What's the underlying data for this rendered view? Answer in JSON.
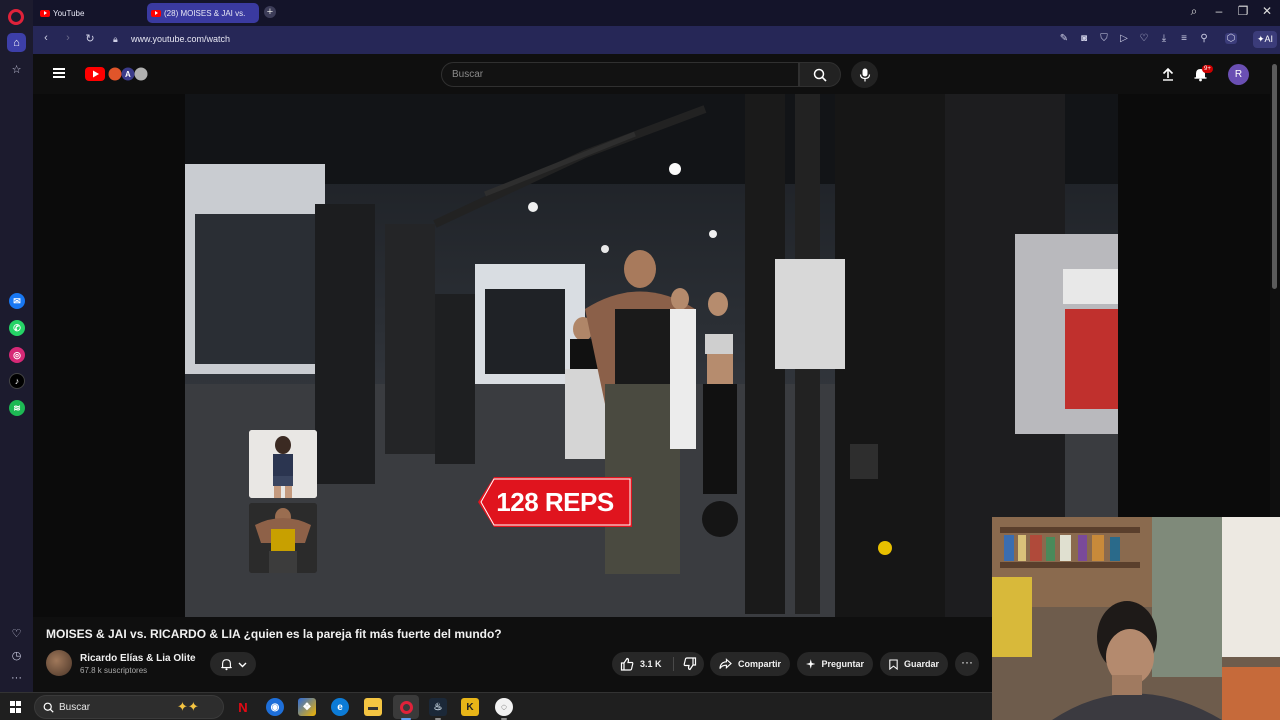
{
  "browser": {
    "tabs": [
      {
        "title": "YouTube",
        "active": false
      },
      {
        "title": "(28) MOISES & JAI vs.",
        "active": true
      }
    ],
    "url": "www.youtube.com/watch",
    "ai_label": "AI"
  },
  "youtube": {
    "search_placeholder": "Buscar",
    "notification_count": "9+",
    "avatar_letter": "R"
  },
  "video": {
    "overlay_reps": "128 REPS",
    "title": "MOISES & JAI vs. RICARDO & LIA ¿quien es la pareja fit más fuerte del mundo?",
    "channel_name": "Ricardo Elías & Lia Olite",
    "subscribers": "67.8 k suscriptores",
    "actions": {
      "likes": "3.1 K",
      "share": "Compartir",
      "ask": "Preguntar",
      "save": "Guardar"
    }
  },
  "taskbar": {
    "search_label": "Buscar"
  },
  "colors": {
    "yt_red": "#ff0000",
    "opera_accent": "#3a3aa0",
    "page_bg": "#0f0f0f"
  }
}
